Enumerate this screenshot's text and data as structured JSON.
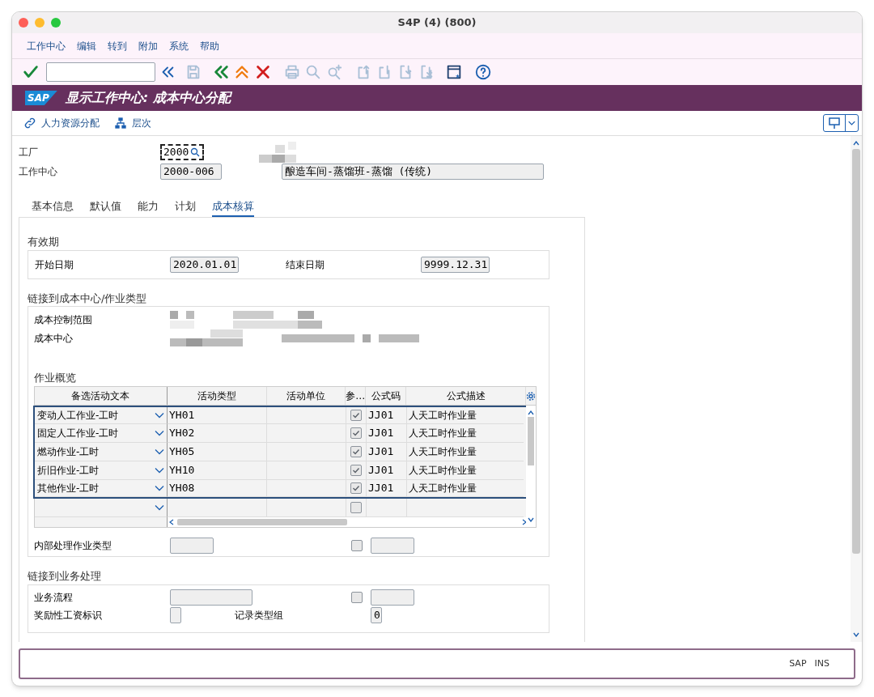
{
  "window": {
    "title": "S4P (4) (800)"
  },
  "menu": [
    "工作中心",
    "编辑",
    "转到",
    "附加",
    "系统",
    "帮助"
  ],
  "title_bar": {
    "logo": "SAP",
    "title": "显示工作中心: 成本中心分配"
  },
  "app_toolbar": [
    {
      "kind": "link",
      "label": "人力资源分配"
    },
    {
      "kind": "hierarchy",
      "label": "层次"
    }
  ],
  "header": {
    "plant": {
      "label": "工厂",
      "value": "2000"
    },
    "work_center": {
      "label": "工作中心",
      "value": "2000-006",
      "description": "酿造车间-蒸馏班-蒸馏 (传统)"
    }
  },
  "tabs": [
    {
      "label": "基本信息",
      "selected": false
    },
    {
      "label": "默认值",
      "selected": false
    },
    {
      "label": "能力",
      "selected": false
    },
    {
      "label": "计划",
      "selected": false
    },
    {
      "label": "成本核算",
      "selected": true
    }
  ],
  "validity": {
    "title": "有效期",
    "start_label": "开始日期",
    "start": "2020.01.01",
    "end_label": "结束日期",
    "end": "9999.12.31"
  },
  "cost_link": {
    "title": "链接到成本中心/作业类型",
    "fields": [
      "成本控制范围",
      "成本中心"
    ]
  },
  "activities": {
    "title": "作业概览",
    "columns": [
      "备选活动文本",
      "活动类型",
      "活动单位",
      "参…",
      "公式码",
      "公式描述"
    ],
    "rows": [
      {
        "text": "变动人工作业-工时",
        "type": "YH01",
        "checked": true,
        "formula": "JJ01",
        "description": "人天工时作业量",
        "selected": true
      },
      {
        "text": "固定人工作业-工时",
        "type": "YH02",
        "checked": true,
        "formula": "JJ01",
        "description": "人天工时作业量",
        "selected": true
      },
      {
        "text": "燃动作业-工时",
        "type": "YH05",
        "checked": true,
        "formula": "JJ01",
        "description": "人天工时作业量",
        "selected": true
      },
      {
        "text": "折旧作业-工时",
        "type": "YH10",
        "checked": true,
        "formula": "JJ01",
        "description": "人天工时作业量",
        "selected": true
      },
      {
        "text": "其他作业-工时",
        "type": "YH08",
        "checked": true,
        "formula": "JJ01",
        "description": "人天工时作业量",
        "selected": true
      },
      {
        "checked": false,
        "selected": false
      }
    ]
  },
  "internal": {
    "label": "内部处理作业类型",
    "checked": false
  },
  "business": {
    "title": "链接到业务处理",
    "process_label": "业务流程",
    "process_checked": false,
    "incentive_label": "奖励性工资标识",
    "record_label": "记录类型组",
    "record_value": "0"
  },
  "status_bar": {
    "system": "SAP",
    "mode": "INS"
  }
}
